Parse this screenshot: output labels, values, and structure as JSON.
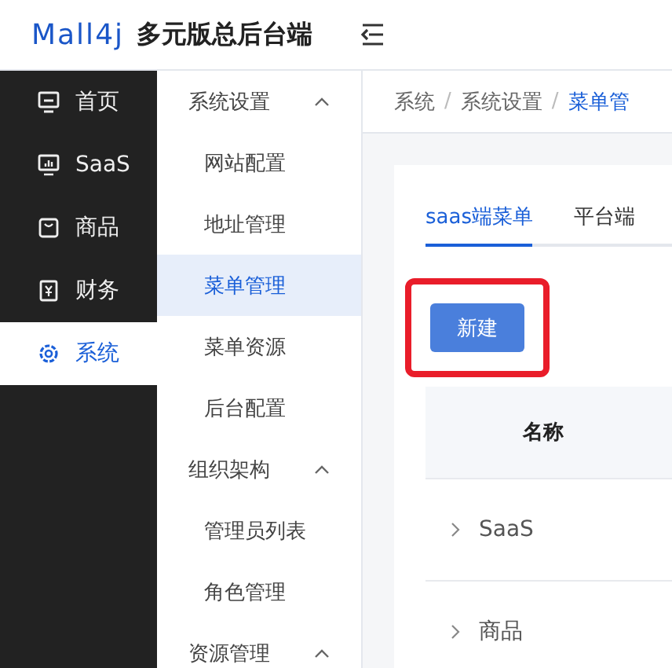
{
  "header": {
    "logo": "Mall4j",
    "title": "多元版总后台端"
  },
  "sidebar": {
    "items": [
      {
        "label": "首页",
        "kind": "home",
        "selected": false
      },
      {
        "label": "SaaS",
        "kind": "saas",
        "selected": false
      },
      {
        "label": "商品",
        "kind": "goods",
        "selected": false
      },
      {
        "label": "财务",
        "kind": "finance",
        "selected": false
      },
      {
        "label": "系统",
        "kind": "system",
        "selected": true
      }
    ]
  },
  "submenu": {
    "groups": [
      {
        "label": "系统设置",
        "expanded": true,
        "children": [
          {
            "label": "网站配置",
            "selected": false
          },
          {
            "label": "地址管理",
            "selected": false
          },
          {
            "label": "菜单管理",
            "selected": true
          },
          {
            "label": "菜单资源",
            "selected": false
          },
          {
            "label": "后台配置",
            "selected": false
          }
        ]
      },
      {
        "label": "组织架构",
        "expanded": true,
        "children": [
          {
            "label": "管理员列表",
            "selected": false
          },
          {
            "label": "角色管理",
            "selected": false
          }
        ]
      },
      {
        "label": "资源管理",
        "expanded": true
      }
    ]
  },
  "breadcrumb": [
    "系统",
    "系统设置",
    "菜单管"
  ],
  "breadcrumb_separator": "/",
  "tabs": [
    {
      "label": "saas端菜单",
      "selected": true
    },
    {
      "label": "平台端",
      "selected": false
    }
  ],
  "new_button": {
    "label": "新建",
    "highlighted": true
  },
  "table": {
    "columns": [
      "名称"
    ],
    "rows": [
      {
        "name": "SaaS",
        "expanded": false
      },
      {
        "name": "商品",
        "expanded": false
      }
    ]
  }
}
